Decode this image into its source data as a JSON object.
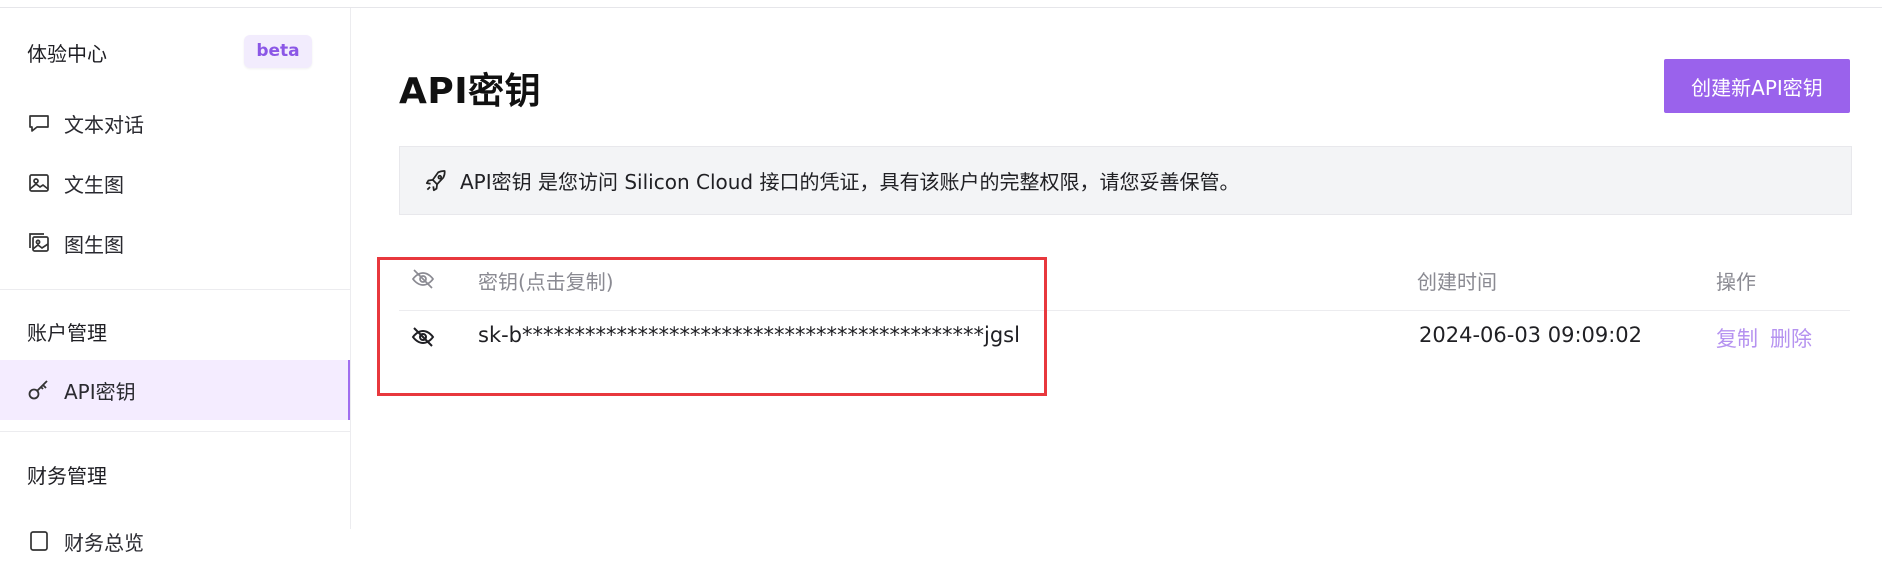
{
  "sidebar": {
    "experience": {
      "title": "体验中心",
      "badge": "beta"
    },
    "items": [
      {
        "label": "文本对话",
        "icon": "chat-bubble-icon"
      },
      {
        "label": "文生图",
        "icon": "image-icon"
      },
      {
        "label": "图生图",
        "icon": "image-stack-icon"
      }
    ],
    "account": {
      "title": "账户管理"
    },
    "api_item": {
      "label": "API密钥",
      "icon": "key-icon"
    },
    "finance": {
      "title": "财务管理"
    },
    "finance_item": {
      "label": "财务总览"
    }
  },
  "main": {
    "title": "API密钥",
    "create_button": "创建新API密钥",
    "notice": {
      "icon": "rocket-icon",
      "text": "API密钥 是您访问 Silicon Cloud 接口的凭证，具有该账户的完整权限，请您妥善保管。"
    },
    "table": {
      "headers": {
        "key": "密钥(点击复制)",
        "created": "创建时间",
        "actions": "操作"
      },
      "rows": [
        {
          "key": "sk-b********************************************jgsl",
          "created": "2024-06-03 09:09:02",
          "copy": "复制",
          "delete": "删除"
        }
      ]
    }
  },
  "colors": {
    "accent": "#9a62ec",
    "highlight_box": "#e8383d",
    "link": "#b592f0"
  }
}
